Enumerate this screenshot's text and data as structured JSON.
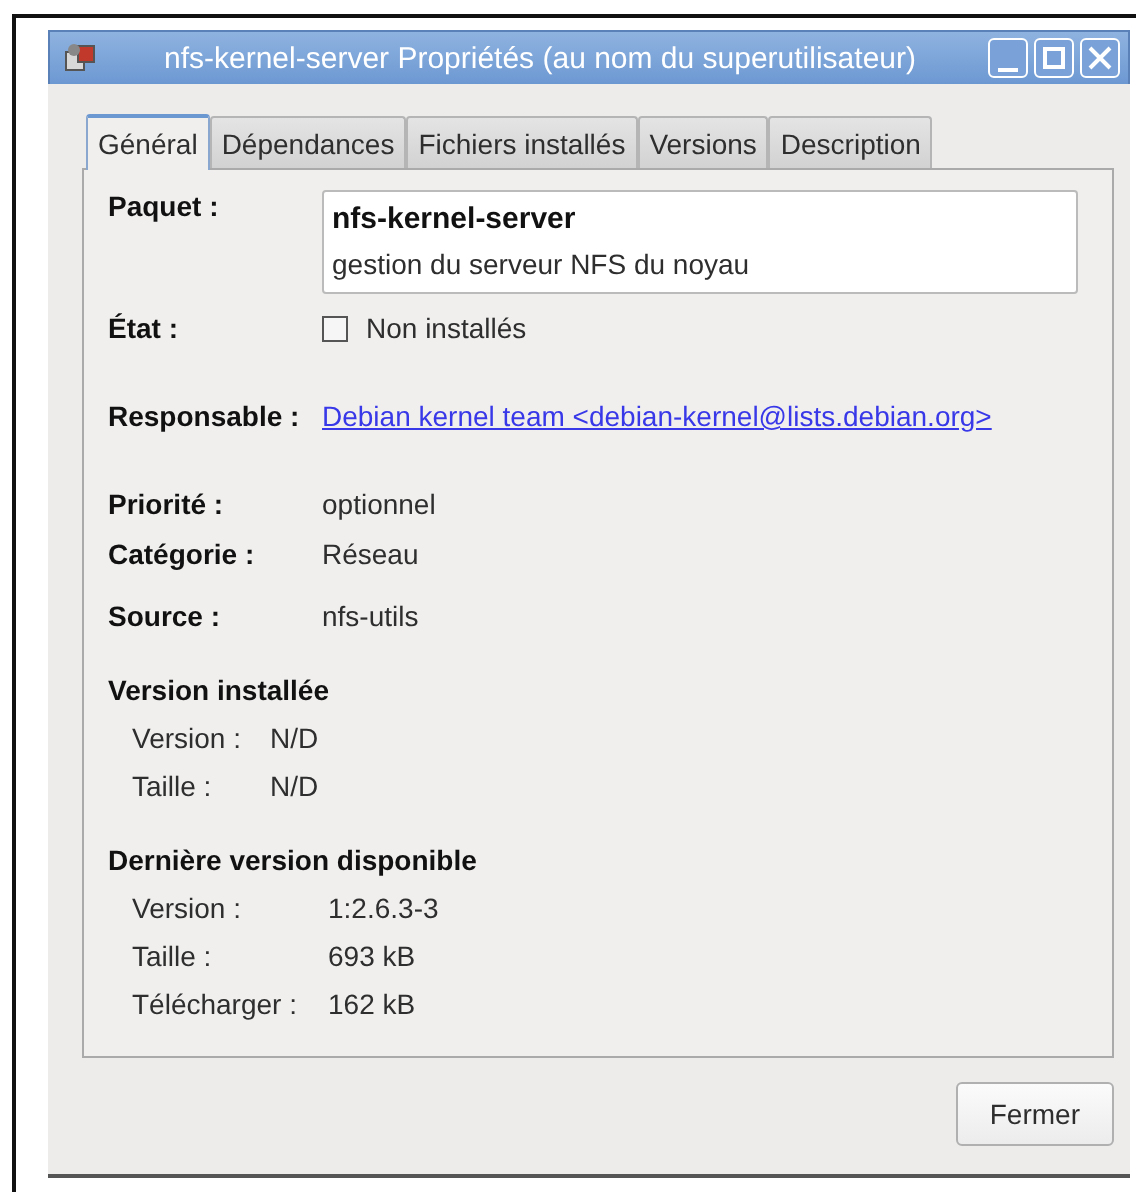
{
  "window": {
    "title": "nfs-kernel-server Propriétés (au nom du superutilisateur)"
  },
  "tabs": [
    {
      "label": "Général",
      "selected": true
    },
    {
      "label": "Dépendances",
      "selected": false
    },
    {
      "label": "Fichiers installés",
      "selected": false
    },
    {
      "label": "Versions",
      "selected": false
    },
    {
      "label": "Description",
      "selected": false
    }
  ],
  "general": {
    "package_label": "Paquet :",
    "package_name": "nfs-kernel-server",
    "package_summary": "gestion du serveur NFS du noyau",
    "state_label": "État :",
    "state": {
      "label": "Non installés",
      "checked": false
    },
    "maintainer_label": "Responsable :",
    "maintainer": "Debian kernel team <debian-kernel@lists.debian.org>",
    "fields": [
      {
        "label": "Priorité :",
        "value": "optionnel"
      },
      {
        "label": "Catégorie :",
        "value": "Réseau"
      },
      {
        "label": "Source :",
        "value": "nfs-utils"
      }
    ],
    "sections": [
      {
        "title": "Version installée",
        "rows": [
          {
            "label": "Version :",
            "value": "N/D"
          },
          {
            "label": "Taille :",
            "value": "N/D"
          }
        ]
      },
      {
        "title": "Dernière version disponible",
        "rows": [
          {
            "label": "Version :",
            "value": "1:2.6.3-3"
          },
          {
            "label": "Taille :",
            "value": "693 kB"
          },
          {
            "label": "Télécharger :",
            "value": "162 kB"
          }
        ]
      }
    ]
  },
  "buttons": [
    "Fermer"
  ]
}
